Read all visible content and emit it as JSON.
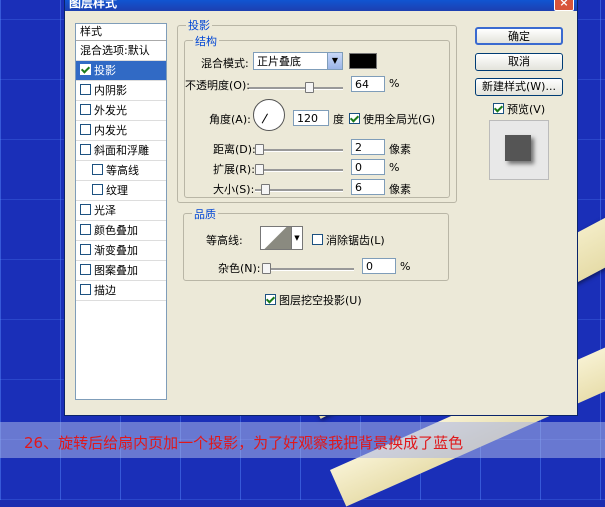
{
  "dialog": {
    "title": "图层样式",
    "close": "×"
  },
  "styles_list": {
    "header": "样式",
    "blend_options": "混合选项:默认",
    "items": [
      {
        "label": "投影",
        "checked": true,
        "selected": true,
        "sub": false
      },
      {
        "label": "内阴影",
        "checked": false,
        "sub": false
      },
      {
        "label": "外发光",
        "checked": false,
        "sub": false
      },
      {
        "label": "内发光",
        "checked": false,
        "sub": false
      },
      {
        "label": "斜面和浮雕",
        "checked": false,
        "sub": false
      },
      {
        "label": "等高线",
        "checked": false,
        "sub": true
      },
      {
        "label": "纹理",
        "checked": false,
        "sub": true
      },
      {
        "label": "光泽",
        "checked": false,
        "sub": false
      },
      {
        "label": "颜色叠加",
        "checked": false,
        "sub": false
      },
      {
        "label": "渐变叠加",
        "checked": false,
        "sub": false
      },
      {
        "label": "图案叠加",
        "checked": false,
        "sub": false
      },
      {
        "label": "描边",
        "checked": false,
        "sub": false
      }
    ]
  },
  "drop_shadow": {
    "section_title": "投影",
    "structure": {
      "title": "结构",
      "blend_mode_label": "混合模式:",
      "blend_mode_value": "正片叠底",
      "shadow_color": "#000000",
      "opacity_label": "不透明度(O):",
      "opacity_value": "64",
      "opacity_unit": "%",
      "opacity_fraction": 0.64,
      "angle_label": "角度(A):",
      "angle_value": "120",
      "angle_unit": "度",
      "global_light_label": "使用全局光(G)",
      "global_light_checked": true,
      "distance_label": "距离(D):",
      "distance_value": "2",
      "distance_unit": "像素",
      "spread_label": "扩展(R):",
      "spread_value": "0",
      "spread_unit": "%",
      "size_label": "大小(S):",
      "size_value": "6",
      "size_unit": "像素"
    },
    "quality": {
      "title": "品质",
      "contour_label": "等高线:",
      "antialias_label": "消除锯齿(L)",
      "antialias_checked": false,
      "noise_label": "杂色(N):",
      "noise_value": "0",
      "noise_unit": "%"
    },
    "knockout_label": "图层挖空投影(U)",
    "knockout_checked": true
  },
  "buttons": {
    "ok": "确定",
    "cancel": "取消",
    "new_style": "新建样式(W)...",
    "preview_label": "预览(V)",
    "preview_checked": true
  },
  "caption": "26、旋转后给扇内页加一个投影，为了好观察我把背景换成了蓝色"
}
